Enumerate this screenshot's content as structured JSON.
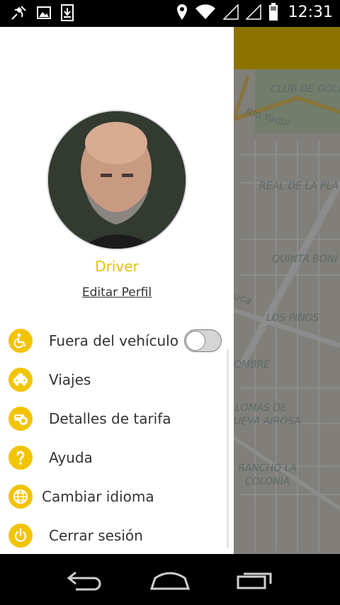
{
  "status_bar": {
    "time": "12:31",
    "left_icons": [
      "satellite-icon",
      "image-icon",
      "download-icon"
    ],
    "right_icons": [
      "location-icon",
      "wifi-icon",
      "signal-icon",
      "signal-icon",
      "battery-icon"
    ]
  },
  "map": {
    "labels": [
      "CLUB DE GOLF",
      "Rio Yaqui",
      "REAL DE LA PLA",
      "QUINTA BONI",
      "uca",
      "LOS PINOS",
      "OMBRE",
      "LOMAS DE",
      "UEVA AIROSA",
      "RANCHO LA",
      "COLONIA"
    ]
  },
  "drawer": {
    "driver_name": "Driver",
    "edit_profile": "Editar Perfil",
    "items": [
      {
        "label": "Fuera del vehículo",
        "icon": "wheelchair-icon",
        "toggle": false
      },
      {
        "label": "Viajes",
        "icon": "taxi-icon"
      },
      {
        "label": "Detalles de tarifa",
        "icon": "fare-icon"
      },
      {
        "label": "Ayuda",
        "icon": "help-icon"
      },
      {
        "label": "Cambiar idioma",
        "icon": "globe-icon"
      },
      {
        "label": "Cerrar sesión",
        "icon": "power-icon"
      }
    ]
  },
  "colors": {
    "accent": "#f2c400",
    "toolbar": "#ffd200",
    "driver_name": "#e6c100"
  }
}
